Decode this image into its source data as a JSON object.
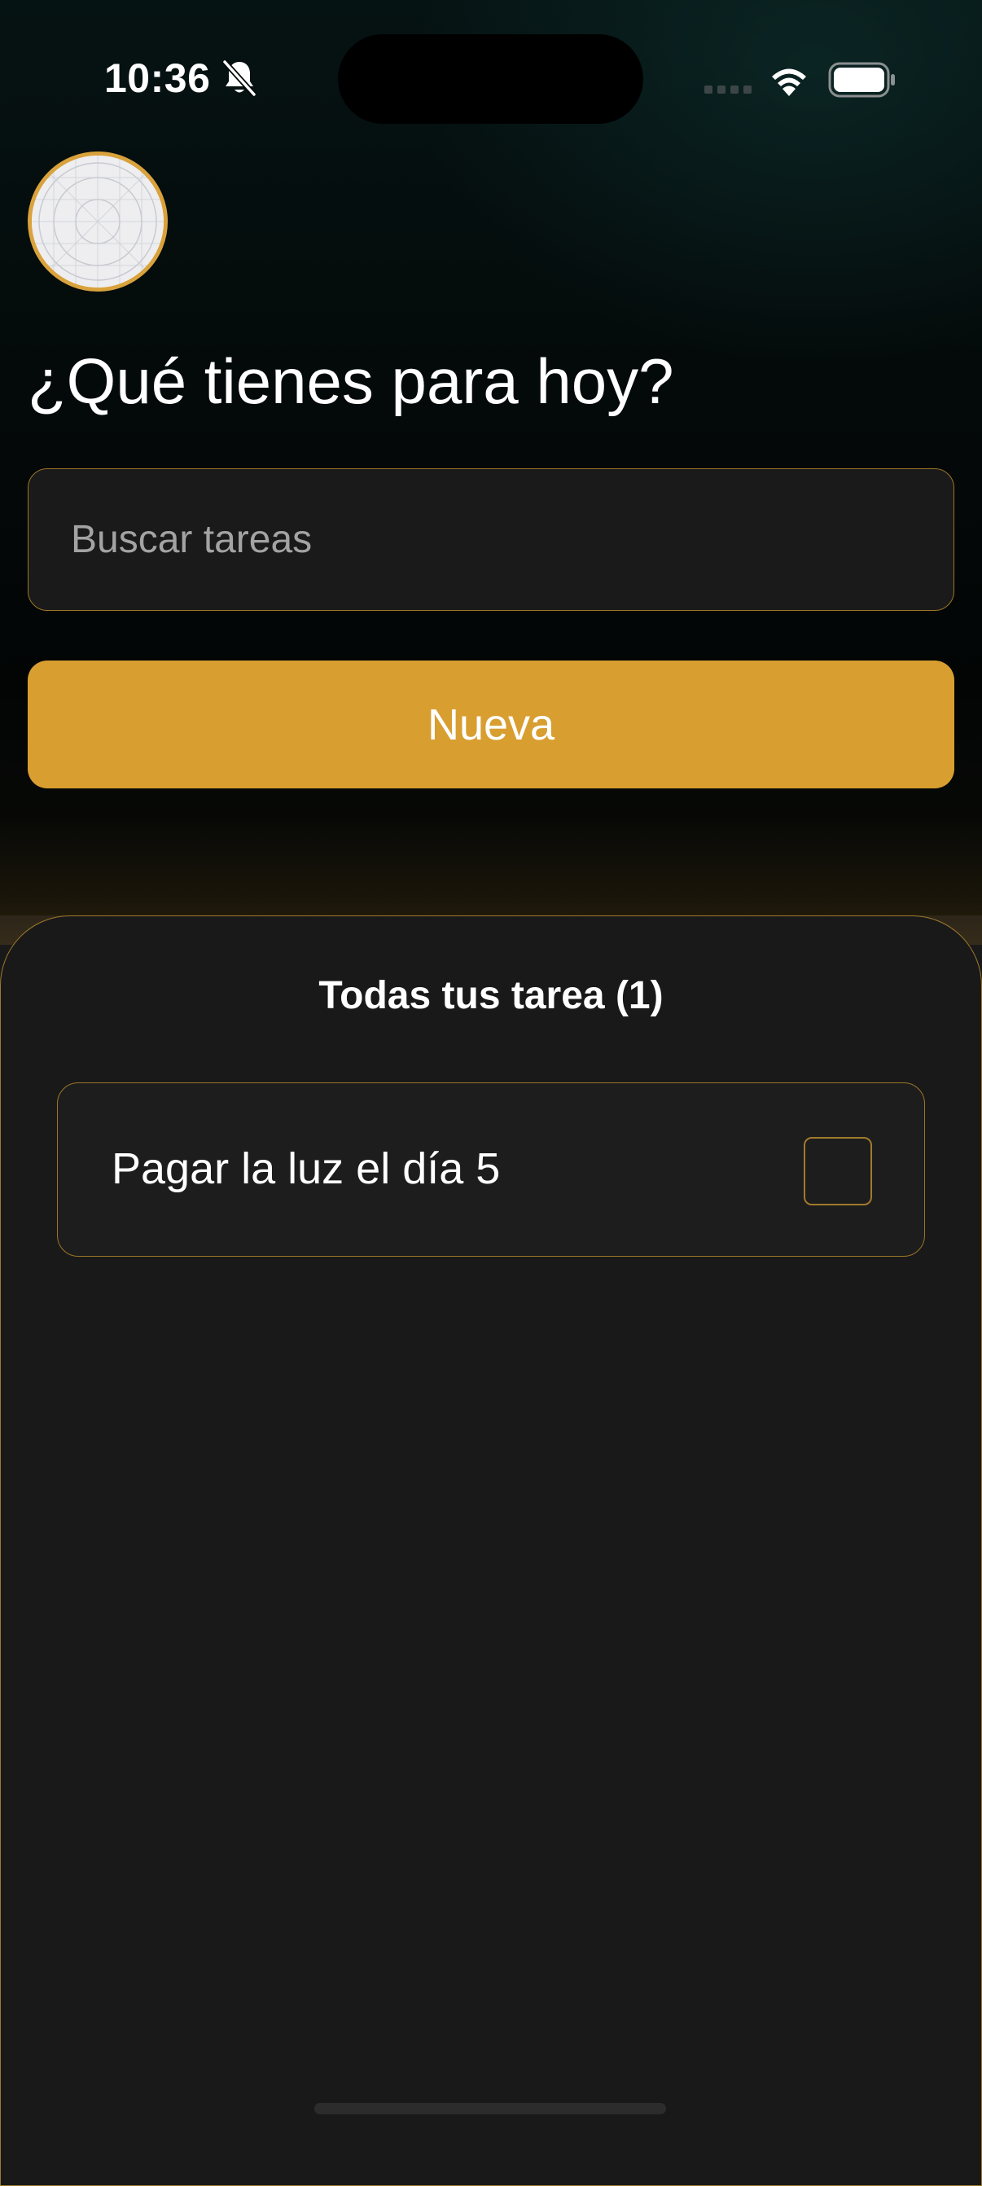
{
  "status_bar": {
    "time": "10:36",
    "icons": [
      "bell-slash-icon",
      "cellular-signal-icon",
      "wifi-icon",
      "battery-icon"
    ]
  },
  "header": {
    "avatar_icon": "avatar-placeholder-icon",
    "title": "¿Qué tienes para hoy?"
  },
  "search": {
    "placeholder": "Buscar tareas",
    "value": ""
  },
  "new_button": {
    "label": "Nueva"
  },
  "task_list": {
    "title": "Todas tus tarea (1)",
    "items": [
      {
        "label": "Pagar la luz el día 5",
        "checked": false
      }
    ]
  },
  "colors": {
    "accent": "#d89e30",
    "accent_border": "#9c7626",
    "sheet_background": "#191919",
    "top_background": "#040909",
    "text": "#ffffff",
    "placeholder": "#a3a3a3"
  }
}
